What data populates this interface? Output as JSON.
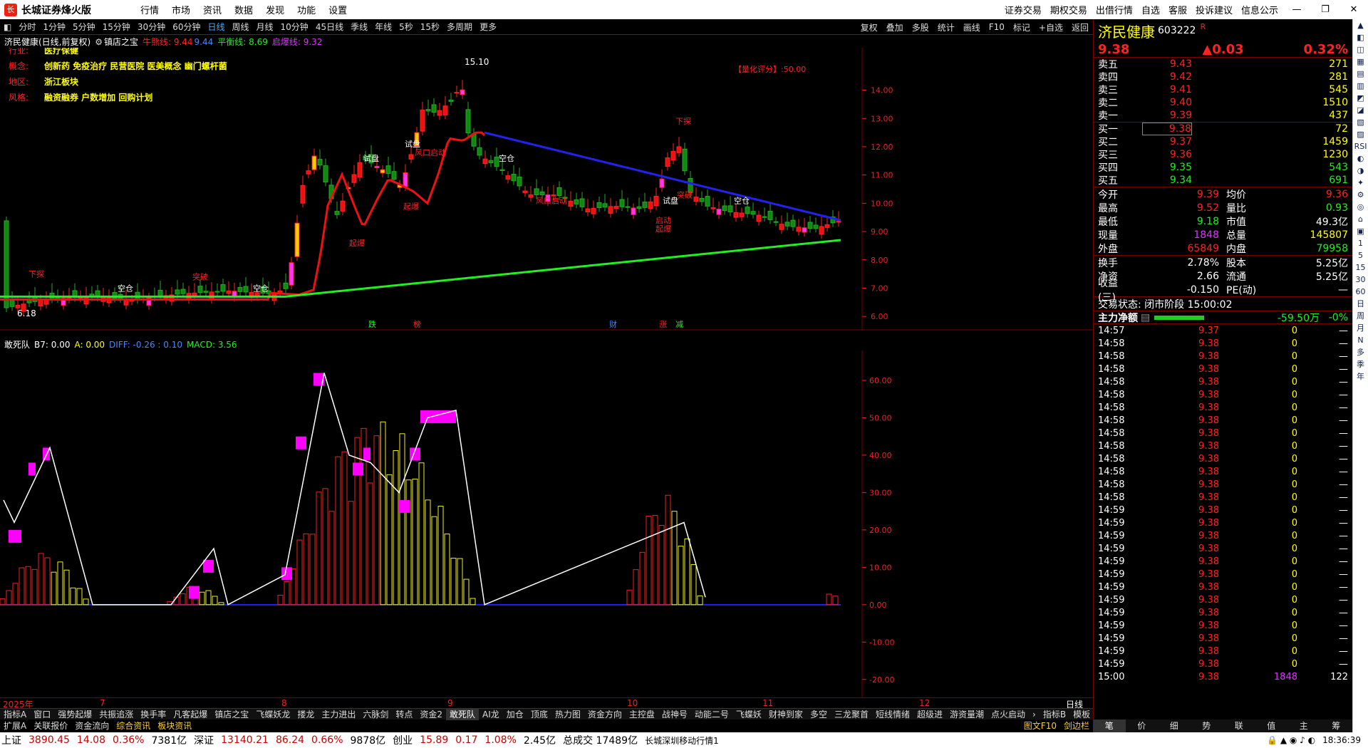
{
  "app": {
    "title": "长城证券烽火版",
    "menus": [
      "行情",
      "市场",
      "资讯",
      "数据",
      "发现",
      "功能",
      "设置"
    ],
    "right_menus": [
      "证券交易",
      "期权交易",
      "出借行情",
      "自选",
      "客服",
      "投诉建议",
      "信息公示"
    ]
  },
  "toolbar": {
    "periods": [
      "分时",
      "1分钟",
      "5分钟",
      "15分钟",
      "30分钟",
      "60分钟",
      "日线",
      "周线",
      "月线",
      "10分钟",
      "45日线",
      "季线",
      "年线",
      "5秒",
      "15秒",
      "多周期",
      "更多"
    ],
    "active": "日线",
    "right": [
      "复权",
      "叠加",
      "多股",
      "统计",
      "画线",
      "F10",
      "标记",
      "+自选",
      "返回"
    ]
  },
  "chart_header": {
    "name": "济民健康(日线,前复权)",
    "indicator": "镇店之宝",
    "bull_label": "牛熊线: 9.44",
    "bull_val": "9.44",
    "balance": "平衡线: 8.69",
    "start": "启爆线: 9.32"
  },
  "info_labels": [
    {
      "k": "行业:",
      "v": "医疗保健"
    },
    {
      "k": "概念:",
      "v": "创新药 免疫治疗 民营医院 医美概念 幽门螺杆菌"
    },
    {
      "k": "地区:",
      "v": "浙江板块"
    },
    {
      "k": "风格:",
      "v": "融资融券 户数增加 回购计划"
    }
  ],
  "score": "【量化评分】:50.00",
  "high_label": "15.10",
  "low_label": "6.18",
  "chart_data": {
    "type": "candlestick",
    "y_axis": [
      "14.00",
      "13.00",
      "12.00",
      "11.00",
      "10.00",
      "9.00",
      "8.00",
      "7.00",
      "6.00"
    ],
    "ylim": [
      5.5,
      15.5
    ]
  },
  "annotations": [
    "下探",
    "空仓",
    "突破",
    "空仓",
    "试盘",
    "起爆",
    "试盘",
    "风口启动",
    "起爆",
    "空仓",
    "风口启动",
    "下探",
    "试盘",
    "启动",
    "突破",
    "起爆",
    "空仓"
  ],
  "event_marks": [
    "跌",
    "榜",
    "财",
    "涨",
    "减"
  ],
  "sub_header": {
    "name": "敢死队",
    "b7": "B7: 0.00",
    "a": "A: 0.00",
    "diff": "DIFF: -0.26 : 0.10",
    "macd": "MACD: 3.56"
  },
  "sub_chart": {
    "y_axis": [
      "60.00",
      "50.00",
      "40.00",
      "30.00",
      "20.00",
      "10.00",
      "0.00",
      "-10.00",
      "-20.00"
    ],
    "ylim": [
      -25,
      68
    ]
  },
  "dates": [
    "2025年",
    "7",
    "8",
    "9",
    "10",
    "11",
    "12"
  ],
  "period_label": "日线",
  "bottom_tabs": [
    "指标A",
    "窗口",
    "强势起爆",
    "共振追涨",
    "换手率",
    "凡客起爆",
    "镇店之宝",
    "飞蝶妖龙",
    "搂龙",
    "主力进出",
    "六脉剑",
    "转点",
    "资金2",
    "敢死队",
    "AI龙",
    "加仓",
    "顶底",
    "热力图",
    "资金方向",
    "主控盘",
    "战神号",
    "动能二号",
    "飞蝶妖",
    "财神到家",
    "多空",
    "三龙聚首",
    "短线情绪",
    "超级进",
    "游资量潮",
    "点火启动"
  ],
  "bottom_tabs_active": "敢死队",
  "bottom_tabs_right": [
    "指标B",
    "模板"
  ],
  "bottom_tabs2": [
    "扩展A",
    "关联报价",
    "资金流向",
    "综合资讯",
    "板块资讯"
  ],
  "bottom_tabs2_right": [
    "图文F10",
    "剑边栏"
  ],
  "status": {
    "sh_label": "上证",
    "sh": "3890.45",
    "sh_chg": "14.08",
    "sh_pct": "0.36%",
    "sh_amt": "7381亿",
    "sz_label": "深证",
    "sz": "13140.21",
    "sz_chg": "86.24",
    "sz_pct": "0.66%",
    "sz_amt": "9878亿",
    "cy_label": "创业",
    "cy": "15.89",
    "cy_chg": "0.17",
    "cy_pct": "1.08%",
    "cy_amt": "2.45亿",
    "total": "总成交 17489亿",
    "feed": "长城深圳移动行情1",
    "time": "18:36:39"
  },
  "quote": {
    "name": "济民健康",
    "code": "603222",
    "r": "R",
    "price": "9.38",
    "change": "▲0.03",
    "pct": "0.32%",
    "asks": [
      {
        "l": "卖五",
        "p": "9.43",
        "v": "271"
      },
      {
        "l": "卖四",
        "p": "9.42",
        "v": "281"
      },
      {
        "l": "卖三",
        "p": "9.41",
        "v": "545"
      },
      {
        "l": "卖二",
        "p": "9.40",
        "v": "1510"
      },
      {
        "l": "卖一",
        "p": "9.39",
        "v": "437"
      }
    ],
    "bids": [
      {
        "l": "买一",
        "p": "9.38",
        "v": "72"
      },
      {
        "l": "买二",
        "p": "9.37",
        "v": "1459"
      },
      {
        "l": "买三",
        "p": "9.36",
        "v": "1230"
      },
      {
        "l": "买四",
        "p": "9.35",
        "v": "543"
      },
      {
        "l": "买五",
        "p": "9.34",
        "v": "691"
      }
    ],
    "stats": [
      {
        "k": "今开",
        "v": "9.39",
        "k2": "均价",
        "v2": "9.36"
      },
      {
        "k": "最高",
        "v": "9.52",
        "k2": "量比",
        "v2": "0.93"
      },
      {
        "k": "最低",
        "v": "9.18",
        "k2": "市值",
        "v2": "49.3亿"
      },
      {
        "k": "现量",
        "v": "1848",
        "k2": "总量",
        "v2": "145807"
      },
      {
        "k": "外盘",
        "v": "65849",
        "k2": "内盘",
        "v2": "79958"
      }
    ],
    "stats2": [
      {
        "k": "换手",
        "v": "2.78%",
        "k2": "股本",
        "v2": "5.25亿"
      },
      {
        "k": "净资",
        "v": "2.66",
        "k2": "流通",
        "v2": "5.25亿"
      },
      {
        "k": "收益(三)",
        "v": "-0.150",
        "k2": "PE(动)",
        "v2": "—"
      }
    ],
    "trade_state": "交易状态: 闭市阶段 15:00:02",
    "main_flow_label": "主力净额",
    "main_flow": "-59.50万",
    "main_flow_pct": "-0%",
    "ticks": [
      [
        "14:57",
        "9.37",
        "0",
        "—"
      ],
      [
        "14:58",
        "9.38",
        "0",
        "—"
      ],
      [
        "14:58",
        "9.38",
        "0",
        "—"
      ],
      [
        "14:58",
        "9.38",
        "0",
        "—"
      ],
      [
        "14:58",
        "9.38",
        "0",
        "—"
      ],
      [
        "14:58",
        "9.38",
        "0",
        "—"
      ],
      [
        "14:58",
        "9.38",
        "0",
        "—"
      ],
      [
        "14:58",
        "9.38",
        "0",
        "—"
      ],
      [
        "14:58",
        "9.38",
        "0",
        "—"
      ],
      [
        "14:58",
        "9.38",
        "0",
        "—"
      ],
      [
        "14:58",
        "9.38",
        "0",
        "—"
      ],
      [
        "14:58",
        "9.38",
        "0",
        "—"
      ],
      [
        "14:58",
        "9.38",
        "0",
        "—"
      ],
      [
        "14:58",
        "9.38",
        "0",
        "—"
      ],
      [
        "14:59",
        "9.38",
        "0",
        "—"
      ],
      [
        "14:59",
        "9.38",
        "0",
        "—"
      ],
      [
        "14:59",
        "9.38",
        "0",
        "—"
      ],
      [
        "14:59",
        "9.38",
        "0",
        "—"
      ],
      [
        "14:59",
        "9.38",
        "0",
        "—"
      ],
      [
        "14:59",
        "9.38",
        "0",
        "—"
      ],
      [
        "14:59",
        "9.38",
        "0",
        "—"
      ],
      [
        "14:59",
        "9.38",
        "0",
        "—"
      ],
      [
        "14:59",
        "9.38",
        "0",
        "—"
      ],
      [
        "14:59",
        "9.38",
        "0",
        "—"
      ],
      [
        "14:59",
        "9.38",
        "0",
        "—"
      ],
      [
        "14:59",
        "9.38",
        "0",
        "—"
      ],
      [
        "14:59",
        "9.38",
        "0",
        "—"
      ],
      [
        "15:00",
        "9.38",
        "1848",
        "122"
      ]
    ],
    "tabs": [
      "笔",
      "价",
      "细",
      "势",
      "联",
      "值",
      "主",
      "筹"
    ]
  },
  "sidebar": [
    "▲",
    "◧",
    "◫",
    "▦",
    "▤",
    "▥",
    "◩",
    "◪",
    "▧",
    "▨",
    "RSI",
    "◐",
    "◑",
    "✦",
    "⚙",
    "◎",
    "⌂",
    "▣",
    "1",
    "5",
    "15",
    "30",
    "60",
    "日",
    "周",
    "月",
    "N",
    "多",
    "季",
    "年"
  ]
}
